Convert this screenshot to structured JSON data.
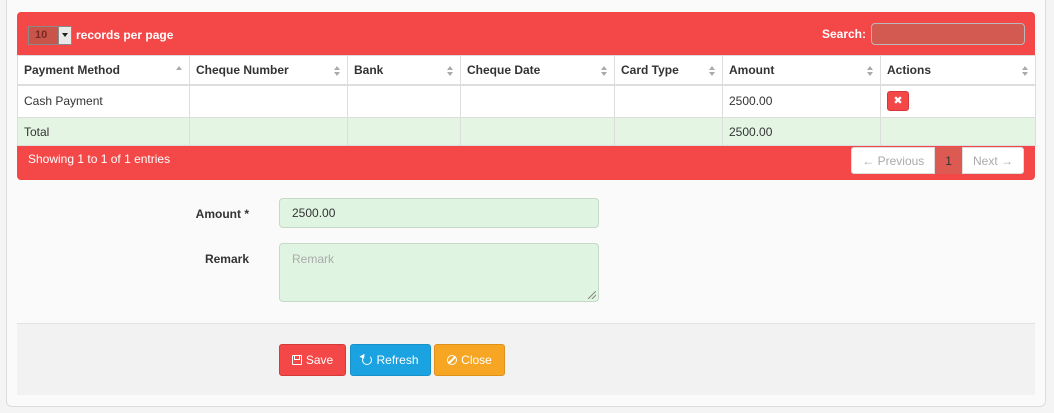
{
  "grid": {
    "page_length": "10",
    "length_label": "records per page",
    "search_label": "Search:",
    "search_value": "",
    "columns": [
      "Payment Method",
      "Cheque Number",
      "Bank",
      "Cheque Date",
      "Card Type",
      "Amount",
      "Actions"
    ],
    "rows": [
      {
        "payment_method": "Cash Payment",
        "cheque_number": "",
        "bank": "",
        "cheque_date": "",
        "card_type": "",
        "amount": "2500.00",
        "delete_glyph": "✖"
      }
    ],
    "total_row": {
      "label": "Total",
      "amount": "2500.00"
    },
    "info": "Showing 1 to 1 of 1 entries",
    "pagination": {
      "previous": "← Previous",
      "current": "1",
      "next": "Next →"
    }
  },
  "form": {
    "amount_label": "Amount *",
    "amount_value": "2500.00",
    "remark_label": "Remark",
    "remark_placeholder": "Remark"
  },
  "buttons": {
    "save": "Save",
    "refresh": "Refresh",
    "close": "Close"
  },
  "colors": {
    "grid_header": "#f44747",
    "total_row": "#e4f5e4",
    "save": "#f44747",
    "refresh": "#1aa3e0",
    "close": "#f6a623"
  }
}
